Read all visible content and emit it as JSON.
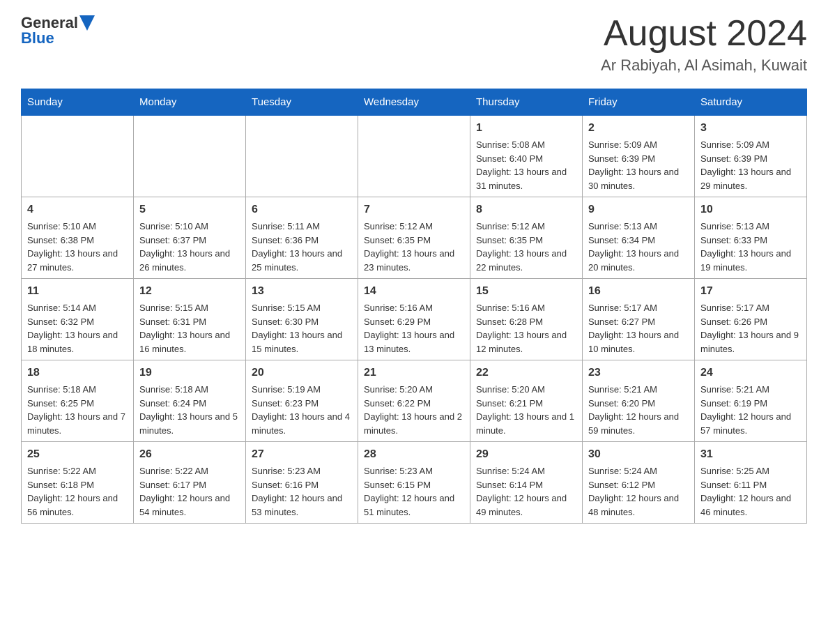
{
  "logo": {
    "general": "General",
    "blue": "Blue"
  },
  "header": {
    "month": "August 2024",
    "location": "Ar Rabiyah, Al Asimah, Kuwait"
  },
  "days_of_week": [
    "Sunday",
    "Monday",
    "Tuesday",
    "Wednesday",
    "Thursday",
    "Friday",
    "Saturday"
  ],
  "weeks": [
    [
      {
        "day": "",
        "info": ""
      },
      {
        "day": "",
        "info": ""
      },
      {
        "day": "",
        "info": ""
      },
      {
        "day": "",
        "info": ""
      },
      {
        "day": "1",
        "info": "Sunrise: 5:08 AM\nSunset: 6:40 PM\nDaylight: 13 hours and 31 minutes."
      },
      {
        "day": "2",
        "info": "Sunrise: 5:09 AM\nSunset: 6:39 PM\nDaylight: 13 hours and 30 minutes."
      },
      {
        "day": "3",
        "info": "Sunrise: 5:09 AM\nSunset: 6:39 PM\nDaylight: 13 hours and 29 minutes."
      }
    ],
    [
      {
        "day": "4",
        "info": "Sunrise: 5:10 AM\nSunset: 6:38 PM\nDaylight: 13 hours and 27 minutes."
      },
      {
        "day": "5",
        "info": "Sunrise: 5:10 AM\nSunset: 6:37 PM\nDaylight: 13 hours and 26 minutes."
      },
      {
        "day": "6",
        "info": "Sunrise: 5:11 AM\nSunset: 6:36 PM\nDaylight: 13 hours and 25 minutes."
      },
      {
        "day": "7",
        "info": "Sunrise: 5:12 AM\nSunset: 6:35 PM\nDaylight: 13 hours and 23 minutes."
      },
      {
        "day": "8",
        "info": "Sunrise: 5:12 AM\nSunset: 6:35 PM\nDaylight: 13 hours and 22 minutes."
      },
      {
        "day": "9",
        "info": "Sunrise: 5:13 AM\nSunset: 6:34 PM\nDaylight: 13 hours and 20 minutes."
      },
      {
        "day": "10",
        "info": "Sunrise: 5:13 AM\nSunset: 6:33 PM\nDaylight: 13 hours and 19 minutes."
      }
    ],
    [
      {
        "day": "11",
        "info": "Sunrise: 5:14 AM\nSunset: 6:32 PM\nDaylight: 13 hours and 18 minutes."
      },
      {
        "day": "12",
        "info": "Sunrise: 5:15 AM\nSunset: 6:31 PM\nDaylight: 13 hours and 16 minutes."
      },
      {
        "day": "13",
        "info": "Sunrise: 5:15 AM\nSunset: 6:30 PM\nDaylight: 13 hours and 15 minutes."
      },
      {
        "day": "14",
        "info": "Sunrise: 5:16 AM\nSunset: 6:29 PM\nDaylight: 13 hours and 13 minutes."
      },
      {
        "day": "15",
        "info": "Sunrise: 5:16 AM\nSunset: 6:28 PM\nDaylight: 13 hours and 12 minutes."
      },
      {
        "day": "16",
        "info": "Sunrise: 5:17 AM\nSunset: 6:27 PM\nDaylight: 13 hours and 10 minutes."
      },
      {
        "day": "17",
        "info": "Sunrise: 5:17 AM\nSunset: 6:26 PM\nDaylight: 13 hours and 9 minutes."
      }
    ],
    [
      {
        "day": "18",
        "info": "Sunrise: 5:18 AM\nSunset: 6:25 PM\nDaylight: 13 hours and 7 minutes."
      },
      {
        "day": "19",
        "info": "Sunrise: 5:18 AM\nSunset: 6:24 PM\nDaylight: 13 hours and 5 minutes."
      },
      {
        "day": "20",
        "info": "Sunrise: 5:19 AM\nSunset: 6:23 PM\nDaylight: 13 hours and 4 minutes."
      },
      {
        "day": "21",
        "info": "Sunrise: 5:20 AM\nSunset: 6:22 PM\nDaylight: 13 hours and 2 minutes."
      },
      {
        "day": "22",
        "info": "Sunrise: 5:20 AM\nSunset: 6:21 PM\nDaylight: 13 hours and 1 minute."
      },
      {
        "day": "23",
        "info": "Sunrise: 5:21 AM\nSunset: 6:20 PM\nDaylight: 12 hours and 59 minutes."
      },
      {
        "day": "24",
        "info": "Sunrise: 5:21 AM\nSunset: 6:19 PM\nDaylight: 12 hours and 57 minutes."
      }
    ],
    [
      {
        "day": "25",
        "info": "Sunrise: 5:22 AM\nSunset: 6:18 PM\nDaylight: 12 hours and 56 minutes."
      },
      {
        "day": "26",
        "info": "Sunrise: 5:22 AM\nSunset: 6:17 PM\nDaylight: 12 hours and 54 minutes."
      },
      {
        "day": "27",
        "info": "Sunrise: 5:23 AM\nSunset: 6:16 PM\nDaylight: 12 hours and 53 minutes."
      },
      {
        "day": "28",
        "info": "Sunrise: 5:23 AM\nSunset: 6:15 PM\nDaylight: 12 hours and 51 minutes."
      },
      {
        "day": "29",
        "info": "Sunrise: 5:24 AM\nSunset: 6:14 PM\nDaylight: 12 hours and 49 minutes."
      },
      {
        "day": "30",
        "info": "Sunrise: 5:24 AM\nSunset: 6:12 PM\nDaylight: 12 hours and 48 minutes."
      },
      {
        "day": "31",
        "info": "Sunrise: 5:25 AM\nSunset: 6:11 PM\nDaylight: 12 hours and 46 minutes."
      }
    ]
  ]
}
